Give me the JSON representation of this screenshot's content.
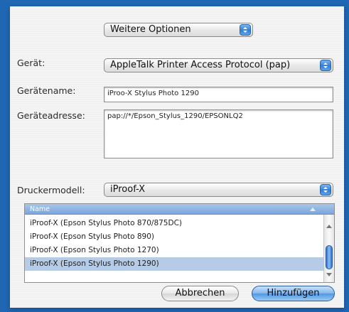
{
  "options_popup": {
    "value": "Weitere Optionen"
  },
  "device": {
    "label": "Gerät:",
    "value": "AppleTalk Printer Access Protocol (pap)"
  },
  "device_name": {
    "label": "Gerätename:",
    "value": "iProo-X Stylus Photo 1290"
  },
  "device_address": {
    "label": "Geräteadresse:",
    "value": "pap://*/Epson_Stylus_1290/EPSONLQ2"
  },
  "printer_model": {
    "label": "Druckermodell:",
    "value": "iProof-X"
  },
  "model_list": {
    "header": "Name",
    "items": [
      "iProof-X (Epson Stylus Photo 870/875DC)",
      "iProof-X (Epson Stylus Photo 890)",
      "iProof-X (Epson Stylus Photo 1270)",
      "iProof-X (Epson Stylus Photo 1290)"
    ],
    "selected_index": 3
  },
  "buttons": {
    "cancel": "Abbrechen",
    "add": "Hinzufügen"
  },
  "colors": {
    "frame": "#1f66b3",
    "accent": "#2f7fd6",
    "selection": "#b6cbe6"
  }
}
